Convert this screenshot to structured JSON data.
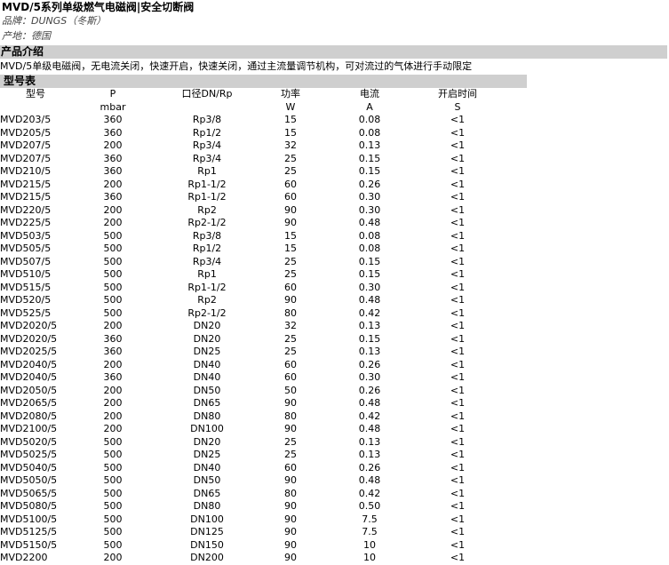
{
  "title": "MVD/5系列单级燃气电磁阀|安全切断阀",
  "brand": "品牌：DUNGS（冬斯）",
  "origin": "产地：德国",
  "intro_header": "产品介绍",
  "intro_text": "MVD/5单级电磁阀，无电流关闭，快速开启，快速关闭，通过主流量调节机构，可对流过的气体进行手动限定",
  "models_header": "型号表",
  "table": {
    "headers_row1": [
      "型号",
      "P",
      "口径DN/Rp",
      "功率",
      "电流",
      "开启时间"
    ],
    "headers_row2": [
      "",
      "mbar",
      "",
      "W",
      "A",
      "S"
    ],
    "rows": [
      [
        "MVD203/5",
        "360",
        "Rp3/8",
        "15",
        "0.08",
        "<1"
      ],
      [
        "MVD205/5",
        "360",
        "Rp1/2",
        "15",
        "0.08",
        "<1"
      ],
      [
        "MVD207/5",
        "200",
        "Rp3/4",
        "32",
        "0.13",
        "<1"
      ],
      [
        "MVD207/5",
        "360",
        "Rp3/4",
        "25",
        "0.15",
        "<1"
      ],
      [
        "MVD210/5",
        "360",
        "Rp1",
        "25",
        "0.15",
        "<1"
      ],
      [
        "MVD215/5",
        "200",
        "Rp1-1/2",
        "60",
        "0.26",
        "<1"
      ],
      [
        "MVD215/5",
        "360",
        "Rp1-1/2",
        "60",
        "0.30",
        "<1"
      ],
      [
        "MVD220/5",
        "200",
        "Rp2",
        "90",
        "0.30",
        "<1"
      ],
      [
        "MVD225/5",
        "200",
        "Rp2-1/2",
        "90",
        "0.48",
        "<1"
      ],
      [
        "MVD503/5",
        "500",
        "Rp3/8",
        "15",
        "0.08",
        "<1"
      ],
      [
        "MVD505/5",
        "500",
        "Rp1/2",
        "15",
        "0.08",
        "<1"
      ],
      [
        "MVD507/5",
        "500",
        "Rp3/4",
        "25",
        "0.15",
        "<1"
      ],
      [
        "MVD510/5",
        "500",
        "Rp1",
        "25",
        "0.15",
        "<1"
      ],
      [
        "MVD515/5",
        "500",
        "Rp1-1/2",
        "60",
        "0.30",
        "<1"
      ],
      [
        "MVD520/5",
        "500",
        "Rp2",
        "90",
        "0.48",
        "<1"
      ],
      [
        "MVD525/5",
        "500",
        "Rp2-1/2",
        "80",
        "0.42",
        "<1"
      ],
      [
        "MVD2020/5",
        "200",
        "DN20",
        "32",
        "0.13",
        "<1"
      ],
      [
        "MVD2020/5",
        "360",
        "DN20",
        "25",
        "0.15",
        "<1"
      ],
      [
        "MVD2025/5",
        "360",
        "DN25",
        "25",
        "0.13",
        "<1"
      ],
      [
        "MVD2040/5",
        "200",
        "DN40",
        "60",
        "0.26",
        "<1"
      ],
      [
        "MVD2040/5",
        "360",
        "DN40",
        "60",
        "0.30",
        "<1"
      ],
      [
        "MVD2050/5",
        "200",
        "DN50",
        "50",
        "0.26",
        "<1"
      ],
      [
        "MVD2065/5",
        "200",
        "DN65",
        "90",
        "0.48",
        "<1"
      ],
      [
        "MVD2080/5",
        "200",
        "DN80",
        "80",
        "0.42",
        "<1"
      ],
      [
        "MVD2100/5",
        "200",
        "DN100",
        "90",
        "0.48",
        "<1"
      ],
      [
        "MVD5020/5",
        "500",
        "DN20",
        "25",
        "0.13",
        "<1"
      ],
      [
        "MVD5025/5",
        "500",
        "DN25",
        "25",
        "0.13",
        "<1"
      ],
      [
        "MVD5040/5",
        "500",
        "DN40",
        "60",
        "0.26",
        "<1"
      ],
      [
        "MVD5050/5",
        "500",
        "DN50",
        "90",
        "0.48",
        "<1"
      ],
      [
        "MVD5065/5",
        "500",
        "DN65",
        "80",
        "0.42",
        "<1"
      ],
      [
        "MVD5080/5",
        "500",
        "DN80",
        "90",
        "0.50",
        "<1"
      ],
      [
        "MVD5100/5",
        "500",
        "DN100",
        "90",
        "7.5",
        "<1"
      ],
      [
        "MVD5125/5",
        "500",
        "DN125",
        "90",
        "7.5",
        "<1"
      ],
      [
        "MVD5150/5",
        "500",
        "DN150",
        "90",
        "10",
        "<1"
      ],
      [
        "MVD2200",
        "200",
        "DN200",
        "90",
        "10",
        "<1"
      ]
    ]
  }
}
